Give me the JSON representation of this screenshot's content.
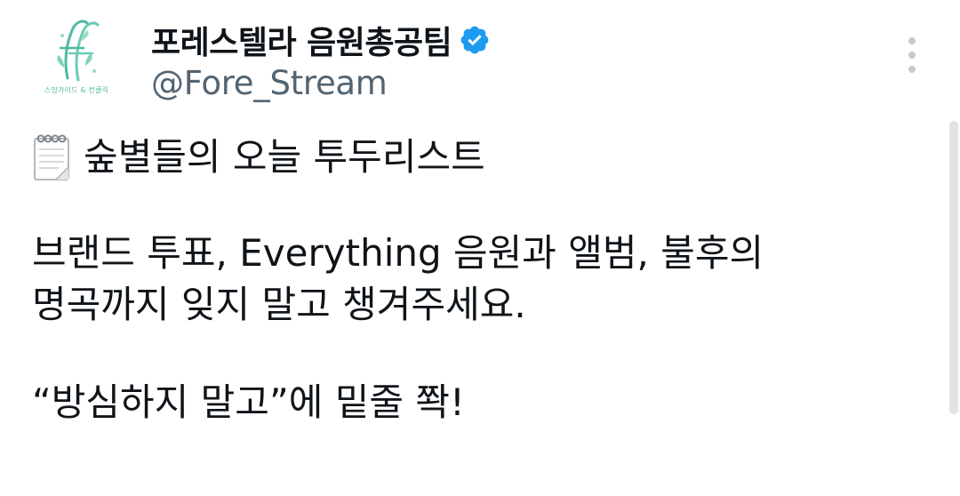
{
  "account": {
    "display_name": "포레스텔라 음원총공팀",
    "handle": "@Fore_Stream",
    "avatar_caption": "스밍가이드 & 컨클릭",
    "verified": true
  },
  "tweet": {
    "line1": "숲별들의 오늘 투두리스트",
    "line2": "브랜드 투표, Everything 음원과 앨범, 불후의",
    "line3": "명곡까지 잊지 말고 챙겨주세요.",
    "line4": "“방심하지 말고”에 밑줄 쫙!"
  },
  "icons": {
    "verified": "verified-badge-icon",
    "more": "more-options-icon",
    "notepad": "spiral-notepad-icon"
  },
  "colors": {
    "verified_blue": "#1d9bf0",
    "handle_gray": "#536471",
    "avatar_teal": "#4fb8a4"
  }
}
